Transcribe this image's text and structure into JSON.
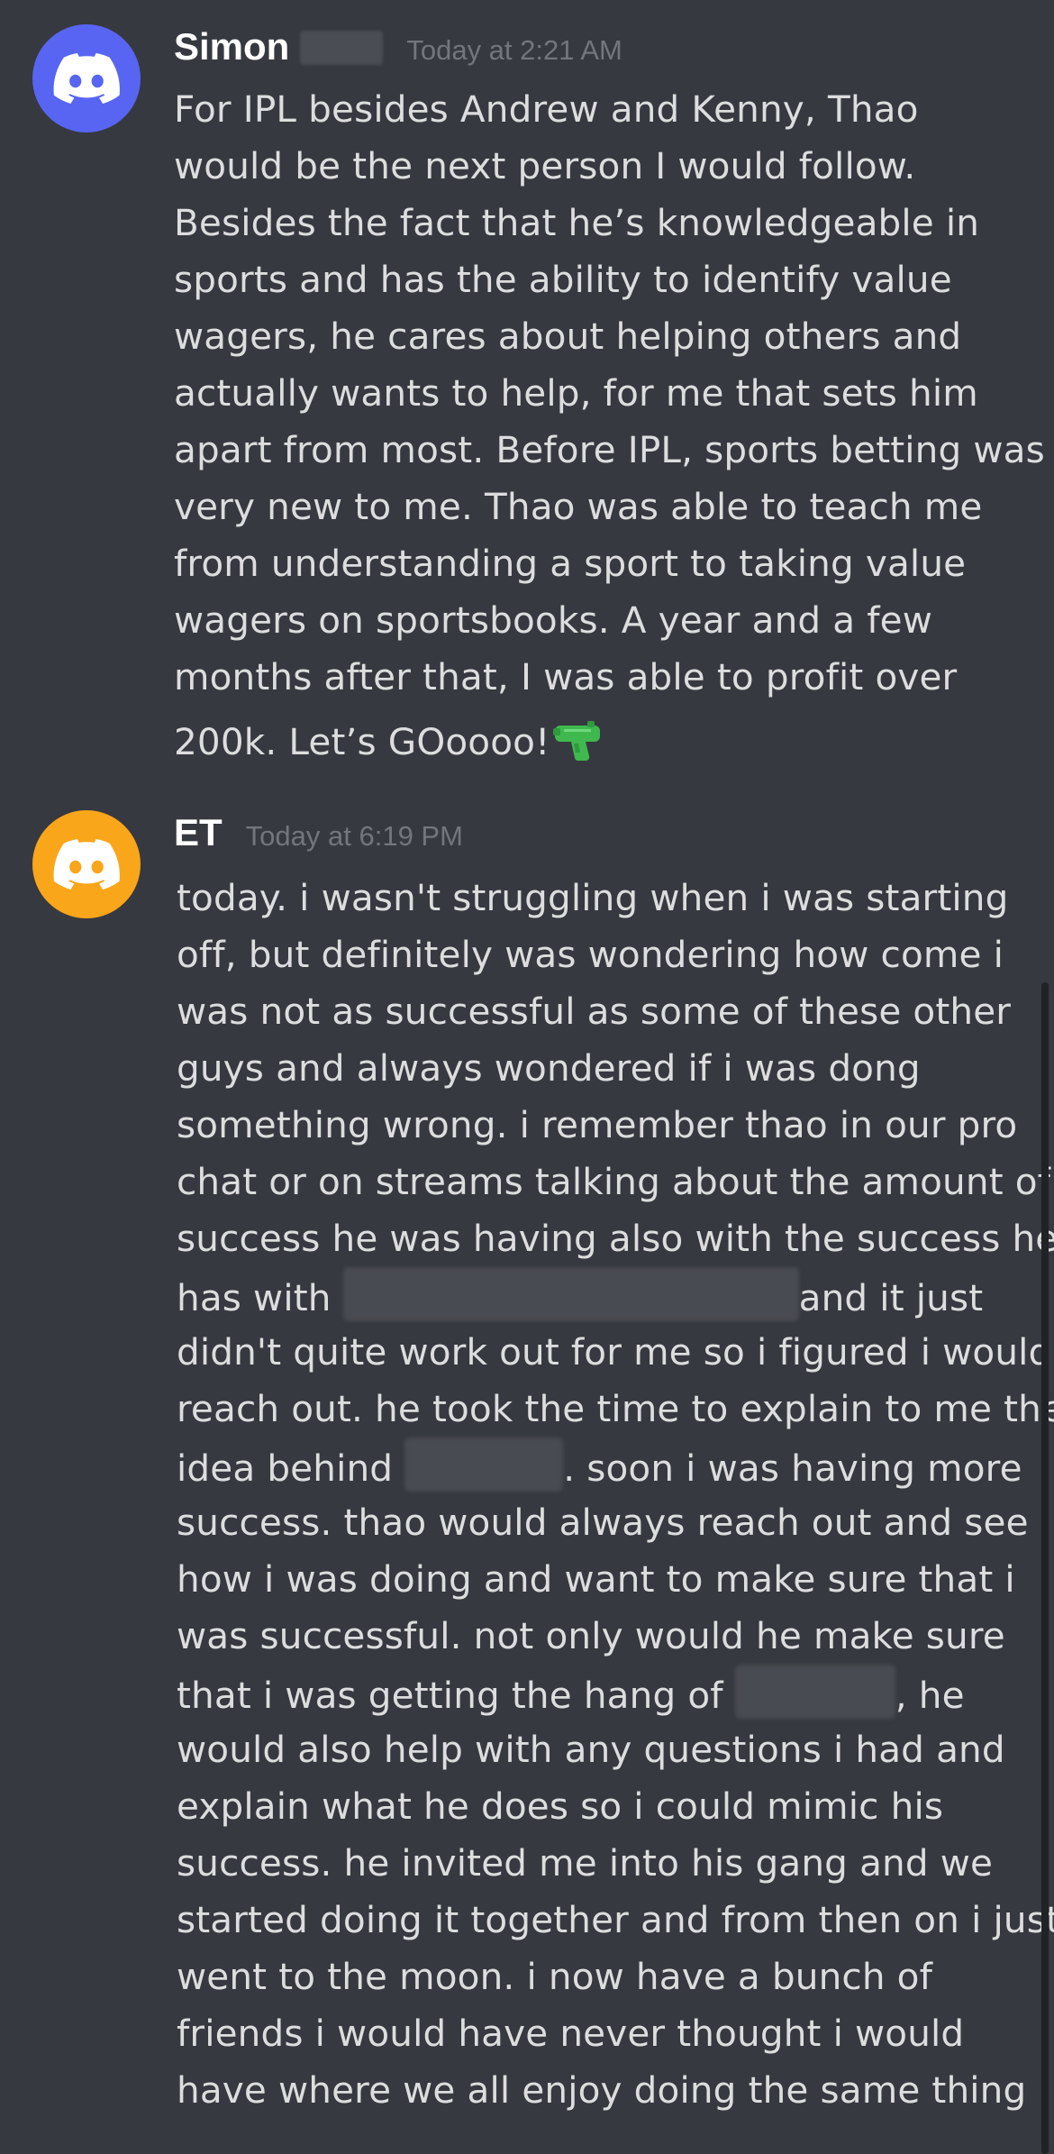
{
  "messages": [
    {
      "username": "Simon",
      "timestamp": "Today at 2:21 AM",
      "avatar_icon": "discord-logo-icon",
      "avatar_color": "#5865f2",
      "lines": [
        "For IPL besides Andrew and Kenny, Thao",
        "would be the next person I would follow.",
        "Besides the fact that he’s knowledgeable in",
        "sports and has the ability to identify value",
        "wagers, he cares about helping others and",
        "actually wants to help, for me that sets him",
        "apart from most. Before IPL, sports betting was",
        "very new to me. Thao was able to teach me",
        "from understanding a sport to taking value",
        "wagers on sportsbooks. A year and a few",
        "months after that, I was able to profit over",
        "200k. Let’s GOoooo!"
      ],
      "emoji": "water-pistol-icon"
    },
    {
      "username": "ET",
      "timestamp": "Today at 6:19 PM",
      "avatar_icon": "discord-logo-icon",
      "avatar_color": "#faa61a",
      "lines": [
        "today. i wasn't struggling when i was starting",
        "off, but definitely was wondering how come i",
        "was not as successful as some of these other",
        "guys and always wondered if i was dong",
        "something wrong. i remember thao in our pro",
        "chat or on streams talking about the amount of",
        "success he was having also with the success he",
        "has with",
        "and it just",
        "didn't quite work out for me so i figured i would",
        "reach out. he took the time to explain to me the",
        "idea behind",
        ". soon i was having more",
        "success. thao would always reach out and see",
        "how i was doing and want to make sure that i",
        "was successful. not only would he make sure",
        "that i was getting the hang of",
        ", he",
        "would also help with any questions i had and",
        "explain what he does so i could mimic his",
        "success. he invited me into his gang and we",
        "started doing it together and from then on i just",
        "went to the moon. i now have a bunch of",
        "friends i would have never thought i would",
        "have where we all enjoy doing the same thing"
      ]
    }
  ],
  "colors": {
    "background": "#36393f",
    "text": "#dcddde",
    "username": "#ffffff",
    "timestamp": "#72767d"
  }
}
